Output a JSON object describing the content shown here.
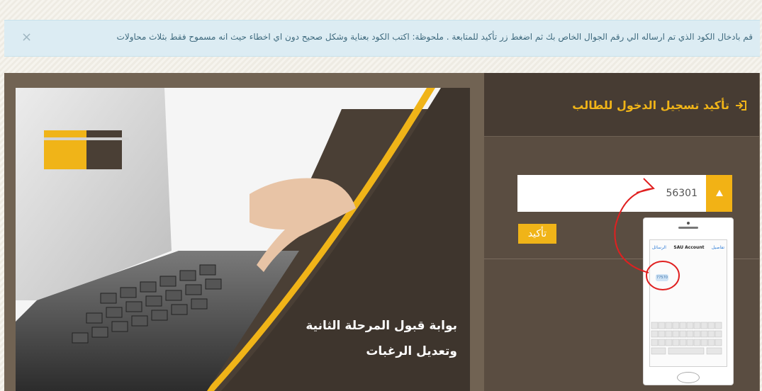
{
  "alert": {
    "message": "قم بادخال الكود الذي تم ارساله الي رقم الجوال الخاص بك ثم اضغط زر تأكيد للمتابعة . ملحوظة: اكتب الكود بعناية وشكل صحيح دون اي اخطاء حيث انه مسموح فقط بثلاث محاولات",
    "close_label": "×"
  },
  "login": {
    "title": "تأكيد تسجيل الدخول للطالب",
    "icon": "sign-in-icon",
    "code_value": "56301",
    "lock_icon": "lock-icon",
    "confirm_label": "تأكيد"
  },
  "promo": {
    "line1": "بوابة قبول المرحلة الثانية",
    "line2": "وتعديل الرغبات"
  },
  "phone": {
    "app_title": "SAU Account",
    "back_label": "الرسائل",
    "edit_label": "تفاصيل",
    "sms_code": "77570"
  },
  "colors": {
    "accent": "#f0b418",
    "panel": "#716353",
    "header": "#473c33",
    "alert_bg": "#dcecf3",
    "arrow": "#e02020"
  }
}
